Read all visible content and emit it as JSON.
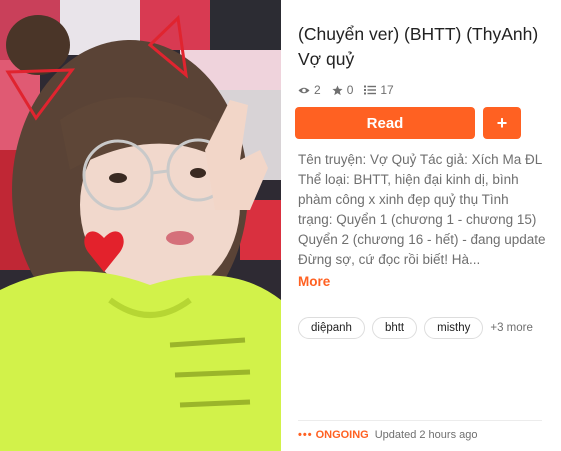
{
  "story": {
    "title": "(Chuyển ver) (BHTT) (ThyAnh) Vợ quỷ",
    "stats": {
      "views": "2",
      "votes": "0",
      "parts": "17"
    },
    "read_label": "Read",
    "add_label": "+",
    "description": "Tên truyện: Vợ Quỷ Tác giả: Xích Ma ĐL Thể loại: BHTT, hiện đại kinh dị, bình phàm công x xinh đẹp quỷ thụ Tình trạng: Quyển 1 (chương 1 - chương 15) Quyển 2 (chương 16 - hết) - đang update Đừng sợ, cứ đọc rồi biết! Hà...",
    "more_label": "More",
    "tags": [
      "diệpanh",
      "bhtt",
      "misthy"
    ],
    "tags_more": "+3 more",
    "status_dots": "•••",
    "status_label": "ONGOING",
    "updated_label": "Updated 2 hours ago"
  },
  "colors": {
    "accent": "#ff6122",
    "text": "#222222",
    "muted": "#6f6f6f"
  },
  "icons": {
    "views": "eye-icon",
    "votes": "star-icon",
    "parts": "list-icon"
  }
}
